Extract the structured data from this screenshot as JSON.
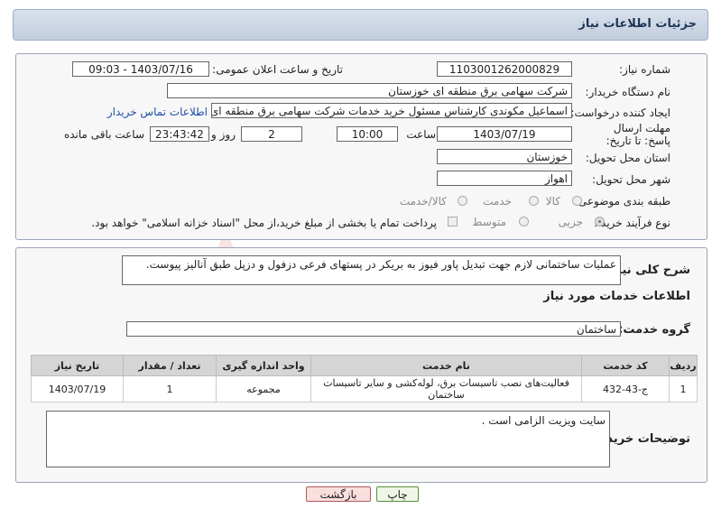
{
  "page": {
    "title": "جزئیات اطلاعات نیاز"
  },
  "watermark": "AriaTender.neT",
  "form": {
    "need_number_label": "شماره نیاز:",
    "need_number": "1103001262000829",
    "announce_label": "تاریخ و ساعت اعلان عمومی:",
    "announce_value": "1403/07/16 - 09:03",
    "buyer_org_label": "نام دستگاه خریدار:",
    "buyer_org": "شرکت سهامی برق منطقه ای خوزستان",
    "creator_label": "ایجاد کننده درخواست:",
    "creator": "اسماعیل مکوندی کارشناس مسئول خرید خدمات شرکت سهامی برق منطقه ای",
    "contact_link": "اطلاعات تماس خریدار",
    "deadline_label": "مهلت ارسال پاسخ: تا تاریخ:",
    "deadline_date": "1403/07/19",
    "time_label": "ساعت",
    "deadline_time": "10:00",
    "days_value": "2",
    "days_label": "روز و",
    "remaining_time": "23:43:42",
    "remaining_label": "ساعت باقی مانده",
    "province_label": "استان محل تحویل:",
    "province": "خوزستان",
    "city_label": "شهر محل تحویل:",
    "city": "اهواز",
    "category_label": "طبقه بندی موضوعی:",
    "category_options": [
      "کالا",
      "خدمت",
      "کالا/خدمت"
    ],
    "purchase_type_label": "نوع فرآیند خرید :",
    "purchase_options": [
      "جزیی",
      "متوسط"
    ],
    "payment_note": "پرداخت تمام یا بخشی از مبلغ خرید،از محل \"اسناد خزانه اسلامی\" خواهد بود."
  },
  "details": {
    "summary_label": "شرح کلی نیاز:",
    "summary": "عملیات ساختمانی لازم جهت تبدیل پاور فیوز به بریکر در پستهای فرعی دزفول و دزپل  طبق آنالیز پیوست.",
    "services_heading": "اطلاعات خدمات مورد نیاز",
    "service_group_label": "گروه خدمت:",
    "service_group": "ساختمان",
    "table_headers": [
      "ردیف",
      "کد خدمت",
      "نام خدمت",
      "واحد اندازه گیری",
      "تعداد / مقدار",
      "تاریخ نیاز"
    ],
    "rows": [
      {
        "index": "1",
        "code": "ج-43-432",
        "name": "فعالیت‌های نصب تاسیسات برق، لوله‌کشی و سایر تاسیسات ساختمان",
        "unit": "مجموعه",
        "qty": "1",
        "date": "1403/07/19"
      }
    ],
    "buyer_notes_label": "توضیحات خریدار:",
    "buyer_notes": "سایت ویزیت الزامی است ."
  },
  "buttons": {
    "print": "چاپ",
    "back": "بازگشت"
  }
}
